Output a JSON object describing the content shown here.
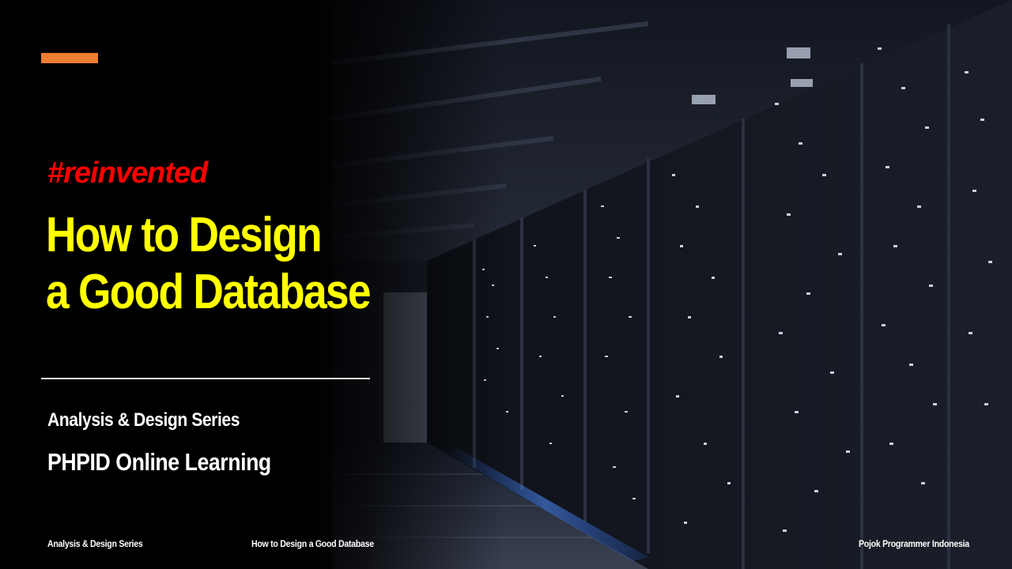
{
  "slide": {
    "hashtag": "#reinvented",
    "title_lines": [
      "How to Design",
      "a Good Database"
    ],
    "subtitle": "Analysis & Design Series",
    "organization": "PHPID Online Learning"
  },
  "footer": {
    "left": "Analysis & Design Series",
    "center": "How to Design a Good Database",
    "right": "Pojok Programmer Indonesia"
  },
  "colors": {
    "accent_bar": "#ed7d31",
    "hashtag": "#ff0000",
    "title": "#ffff00",
    "text": "#ffffff",
    "background": "#000000"
  },
  "background_image": "server-room-photo"
}
